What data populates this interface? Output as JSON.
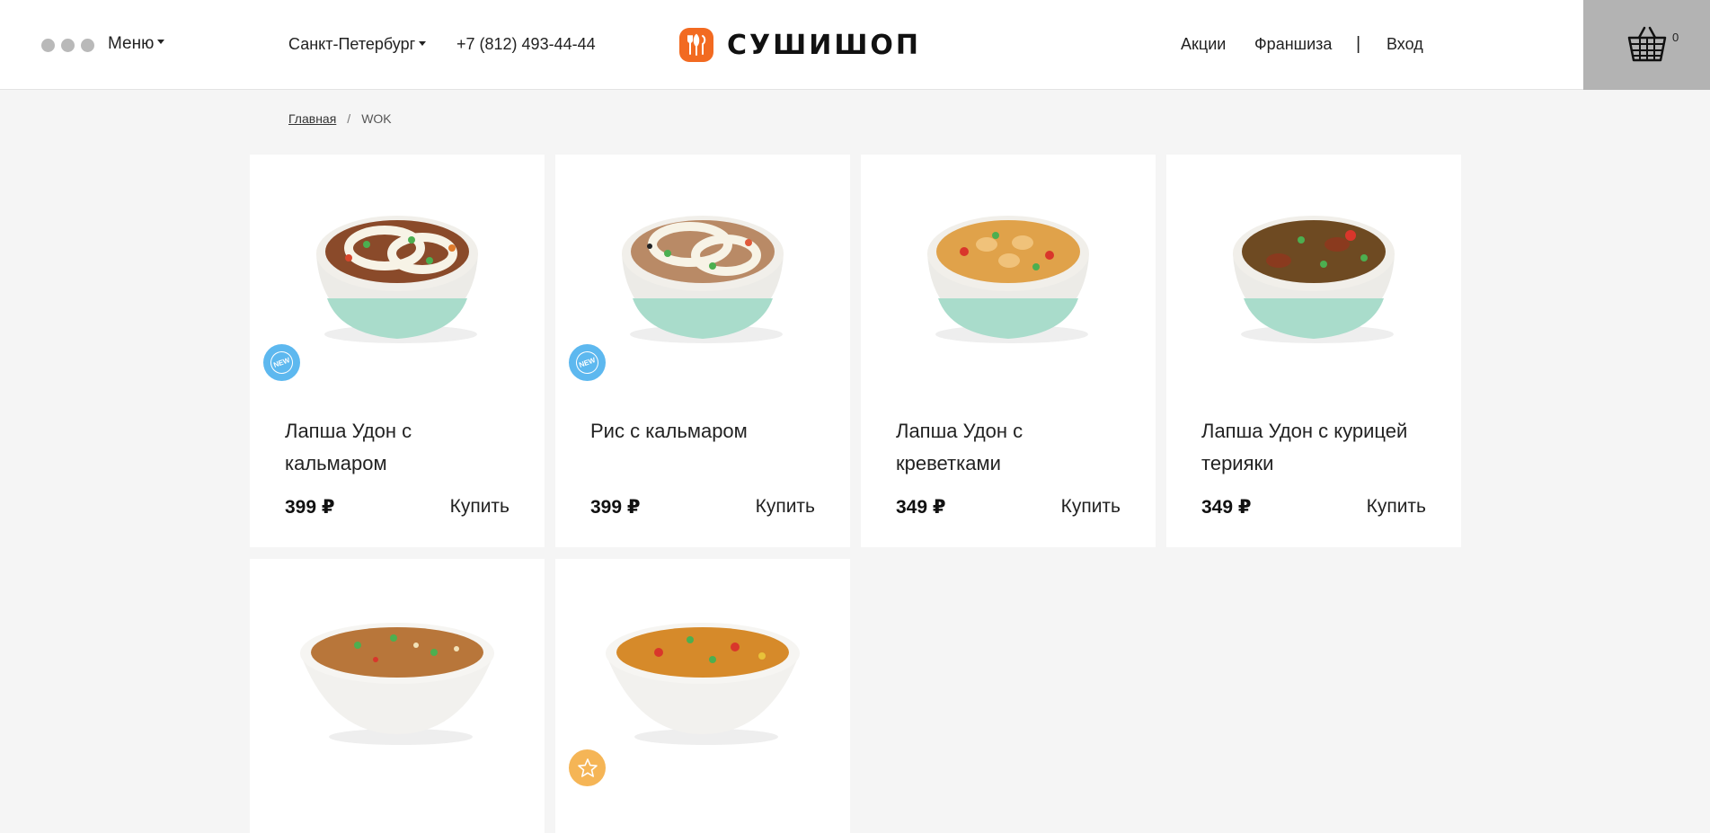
{
  "header": {
    "menu_label": "Меню",
    "city": "Санкт-Петербург",
    "phone": "+7 (812) 493-44-44",
    "logo_text": "СУШИШОП",
    "nav": {
      "promos": "Акции",
      "franchise": "Франшиза",
      "separator": "|",
      "login": "Вход"
    },
    "cart_count": "0"
  },
  "breadcrumb": {
    "home": "Главная",
    "separator": "/",
    "current": "WOK"
  },
  "colors": {
    "brand": "#f26a21",
    "new_badge": "#5db8ef",
    "hit_badge": "#f5b556",
    "cart_bg": "#b3b3b3"
  },
  "products": [
    {
      "title": "Лапша Удон с кальмаром",
      "price": "399 ₽",
      "buy": "Купить",
      "badge": "new"
    },
    {
      "title": "Рис с кальмаром",
      "price": "399 ₽",
      "buy": "Купить",
      "badge": "new"
    },
    {
      "title": "Лапша Удон с креветками",
      "price": "349 ₽",
      "buy": "Купить",
      "badge": ""
    },
    {
      "title": "Лапша Удон с курицей терияки",
      "price": "349 ₽",
      "buy": "Купить",
      "badge": ""
    },
    {
      "badge": ""
    },
    {
      "badge": "hit"
    }
  ]
}
